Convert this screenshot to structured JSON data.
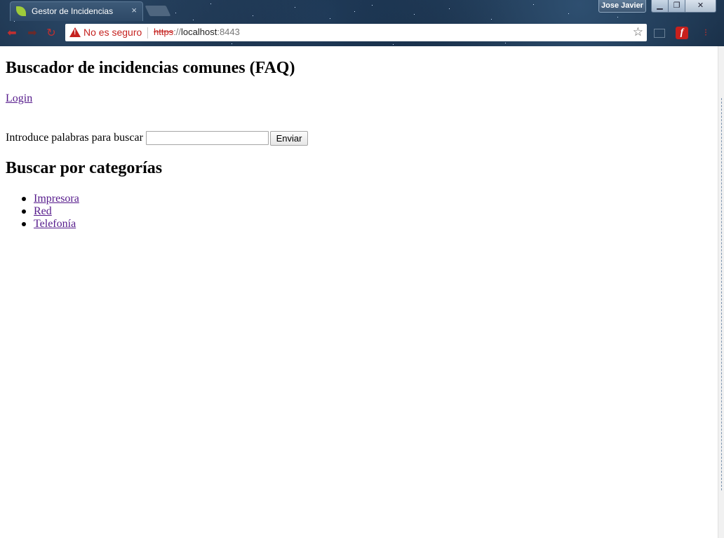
{
  "browser": {
    "tab_title": "Gestor de Incidencias",
    "tab_close": "×",
    "user_name": "Jose Javier",
    "security_label": "No es seguro",
    "url_scheme": "https",
    "url_separator": "://",
    "url_host": "localhost",
    "url_port": ":8443",
    "icons": {
      "back": "back-arrow-icon",
      "forward": "forward-arrow-icon",
      "reload": "reload-icon",
      "warning": "warning-triangle-icon",
      "bookmark": "star-icon",
      "cast": "cast-icon",
      "flash": "flash-icon",
      "menu": "menu-icon"
    }
  },
  "page": {
    "title": "Buscador de incidencias comunes (FAQ)",
    "login_link": "Login",
    "search": {
      "label": "Introduce palabras para buscar",
      "value": "",
      "placeholder": "",
      "submit_label": "Enviar"
    },
    "categories": {
      "title": "Buscar por categorías",
      "items": [
        {
          "label": "Impresora"
        },
        {
          "label": "Red"
        },
        {
          "label": "Telefonía"
        }
      ]
    }
  },
  "colors": {
    "link_visited": "#551a8b",
    "insecure_red": "#c5221f"
  }
}
